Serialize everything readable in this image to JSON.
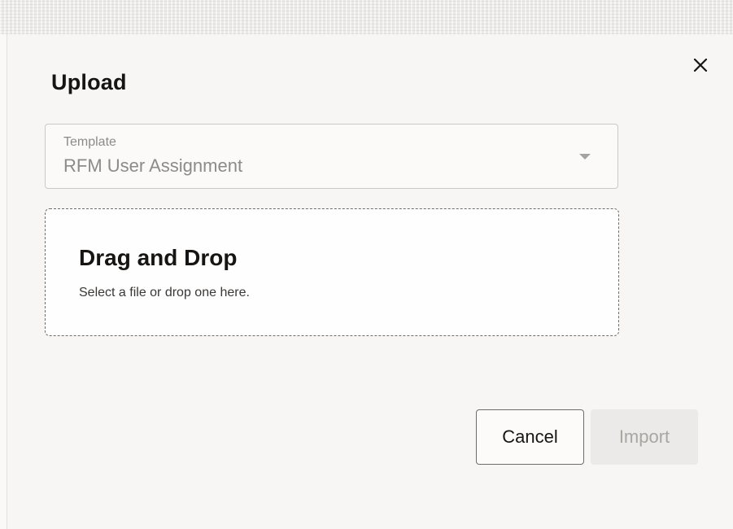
{
  "dialog": {
    "title": "Upload",
    "close_icon": "close-icon"
  },
  "template_select": {
    "label": "Template",
    "value": "RFM User Assignment",
    "icon": "chevron-down-icon"
  },
  "dropzone": {
    "title": "Drag and Drop",
    "subtitle": "Select a file or drop one here."
  },
  "actions": {
    "cancel_label": "Cancel",
    "import_label": "Import",
    "import_enabled": false
  }
}
